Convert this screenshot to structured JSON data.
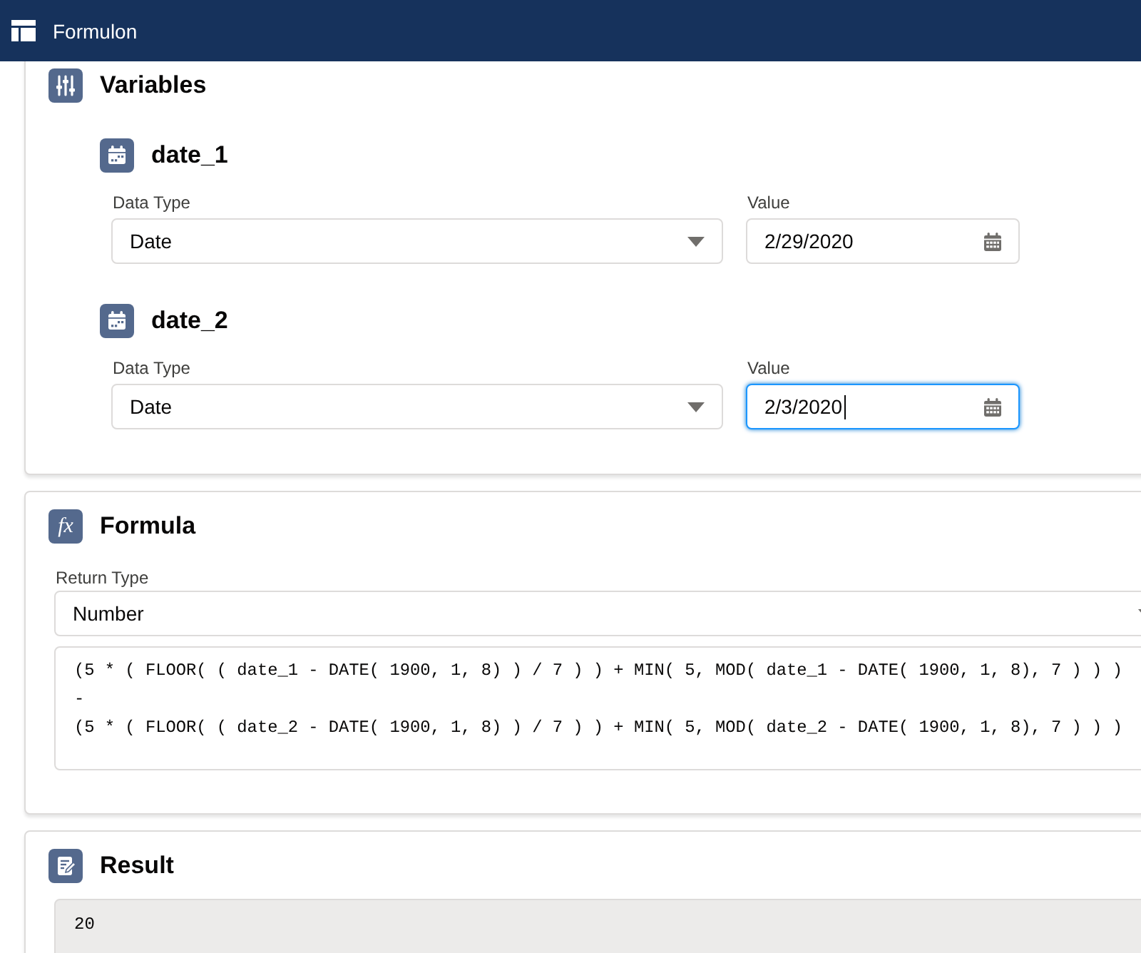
{
  "app_bar": {
    "title": "Formulon"
  },
  "sections": [
    {
      "kind": "variables",
      "title": "Variables",
      "variables": [
        {
          "name": "date_1",
          "data_type": {
            "label": "Data Type",
            "value": "Date"
          },
          "value_field": {
            "label": "Value",
            "value": "2/29/2020",
            "focused": false
          }
        },
        {
          "name": "date_2",
          "data_type": {
            "label": "Data Type",
            "value": "Date"
          },
          "value_field": {
            "label": "Value",
            "value": "2/3/2020",
            "focused": true
          }
        }
      ]
    },
    {
      "kind": "formula",
      "title": "Formula",
      "icon_text": "fx",
      "return_type": {
        "label": "Return Type",
        "value": "Number"
      },
      "formula": "(5 * ( FLOOR( ( date_1 - DATE( 1900, 1, 8) ) / 7 ) ) + MIN( 5, MOD( date_1 - DATE( 1900, 1, 8), 7 ) ) )\n-\n(5 * ( FLOOR( ( date_2 - DATE( 1900, 1, 8) ) / 7 ) ) + MIN( 5, MOD( date_2 - DATE( 1900, 1, 8), 7 ) ) )"
    },
    {
      "kind": "result",
      "title": "Result",
      "value": "20"
    }
  ]
}
